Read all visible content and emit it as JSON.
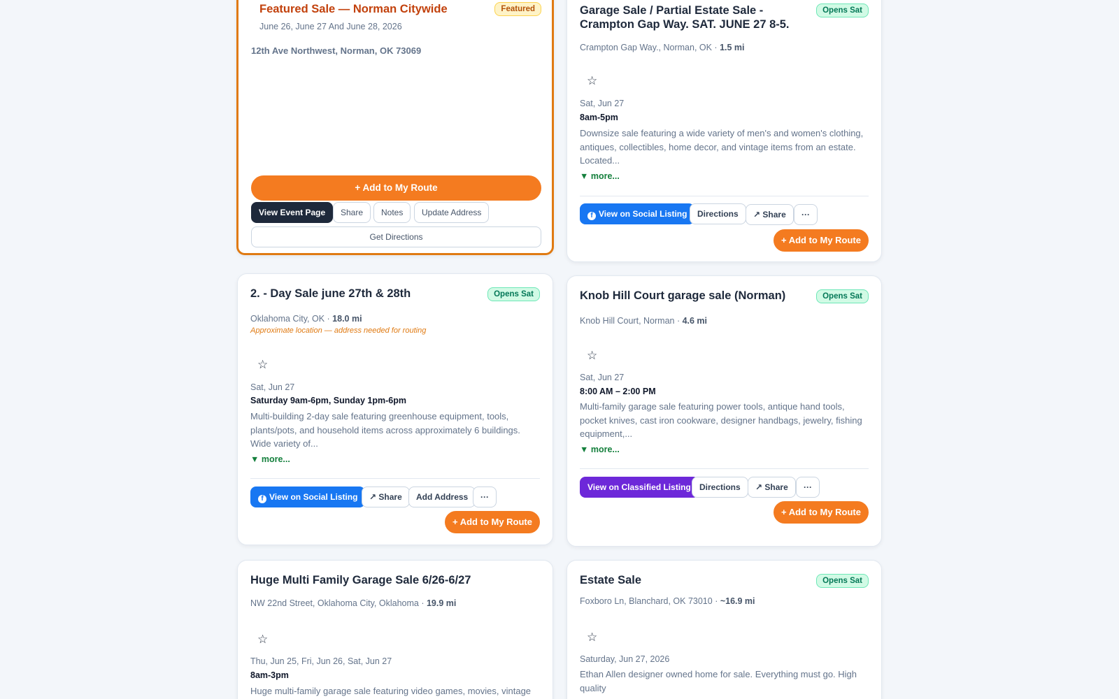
{
  "featured": {
    "title": "Featured Sale — Norman Citywide",
    "badge": "Featured",
    "dates": "June 26, June 27 And June 28, 2026",
    "address": "12th Ave Northwest, Norman, OK 73069",
    "add_route": "+ Add to My Route",
    "view_event": "View Event Page",
    "share": "Share",
    "notes": "Notes",
    "update_address": "Update Address",
    "get_directions": "Get Directions"
  },
  "cards": [
    {
      "title": "Garage Sale / Partial Estate Sale - Crampton Gap Way. SAT. JUNE 27 8-5.",
      "badge": "Opens Sat",
      "location": "Crampton Gap Way., Norman, OK",
      "distance": "1.5 mi",
      "star": "☆",
      "date": "Sat, Jun 27",
      "hours": "8am-5pm",
      "description": "Downsize sale featuring a wide variety of men's and women's clothing, antiques, collectibles, home decor, and vintage items from an estate. Located...",
      "more": "▼ more...",
      "listing_button": "View on Social Listing",
      "directions": "Directions",
      "share": "↗ Share",
      "menu": "···",
      "add_route": "+ Add to My Route"
    },
    {
      "title": "2. - Day Sale june 27th & 28th",
      "badge": "Opens Sat",
      "location": "Oklahoma City, OK",
      "distance": "18.0 mi",
      "approx": "Approximate location — address needed for routing",
      "star": "☆",
      "date": "Sat, Jun 27",
      "hours": "Saturday 9am-6pm, Sunday 1pm-6pm",
      "description": "Multi-building 2-day sale featuring greenhouse equipment, tools, plants/pots, and household items across approximately 6 buildings. Wide variety of...",
      "more": "▼ more...",
      "listing_button": "View on Social Listing",
      "share": "↗ Share",
      "add_address": "Add Address",
      "menu": "···",
      "add_route": "+ Add to My Route"
    },
    {
      "title": "Knob Hill Court garage sale (Norman)",
      "badge": "Opens Sat",
      "location": "Knob Hill Court, Norman",
      "distance": "4.6 mi",
      "star": "☆",
      "date": "Sat, Jun 27",
      "hours": "8:00 AM – 2:00 PM",
      "description": "Multi-family garage sale featuring power tools, antique hand tools, pocket knives, cast iron cookware, designer handbags, jewelry, fishing equipment,...",
      "more": "▼ more...",
      "listing_button": "View on Classified Listing",
      "directions": "Directions",
      "share": "↗ Share",
      "menu": "···",
      "add_route": "+ Add to My Route"
    },
    {
      "title": "Huge Multi Family Garage Sale 6/26-6/27",
      "location": "NW 22nd Street, Oklahoma City, Oklahoma",
      "distance": "19.9 mi",
      "star": "☆",
      "date": "Thu, Jun 25, Fri, Jun 26, Sat, Jun 27",
      "hours": "8am-3pm",
      "description": "Huge multi-family garage sale featuring video games, movies, vintage"
    },
    {
      "title": "Estate Sale",
      "badge": "Opens Sat",
      "location": "Foxboro Ln, Blanchard, OK 73010",
      "distance": "~16.9 mi",
      "star": "☆",
      "date": "Saturday, Jun 27, 2026",
      "description": "Ethan Allen designer owned home for sale. Everything must go. High quality"
    }
  ]
}
